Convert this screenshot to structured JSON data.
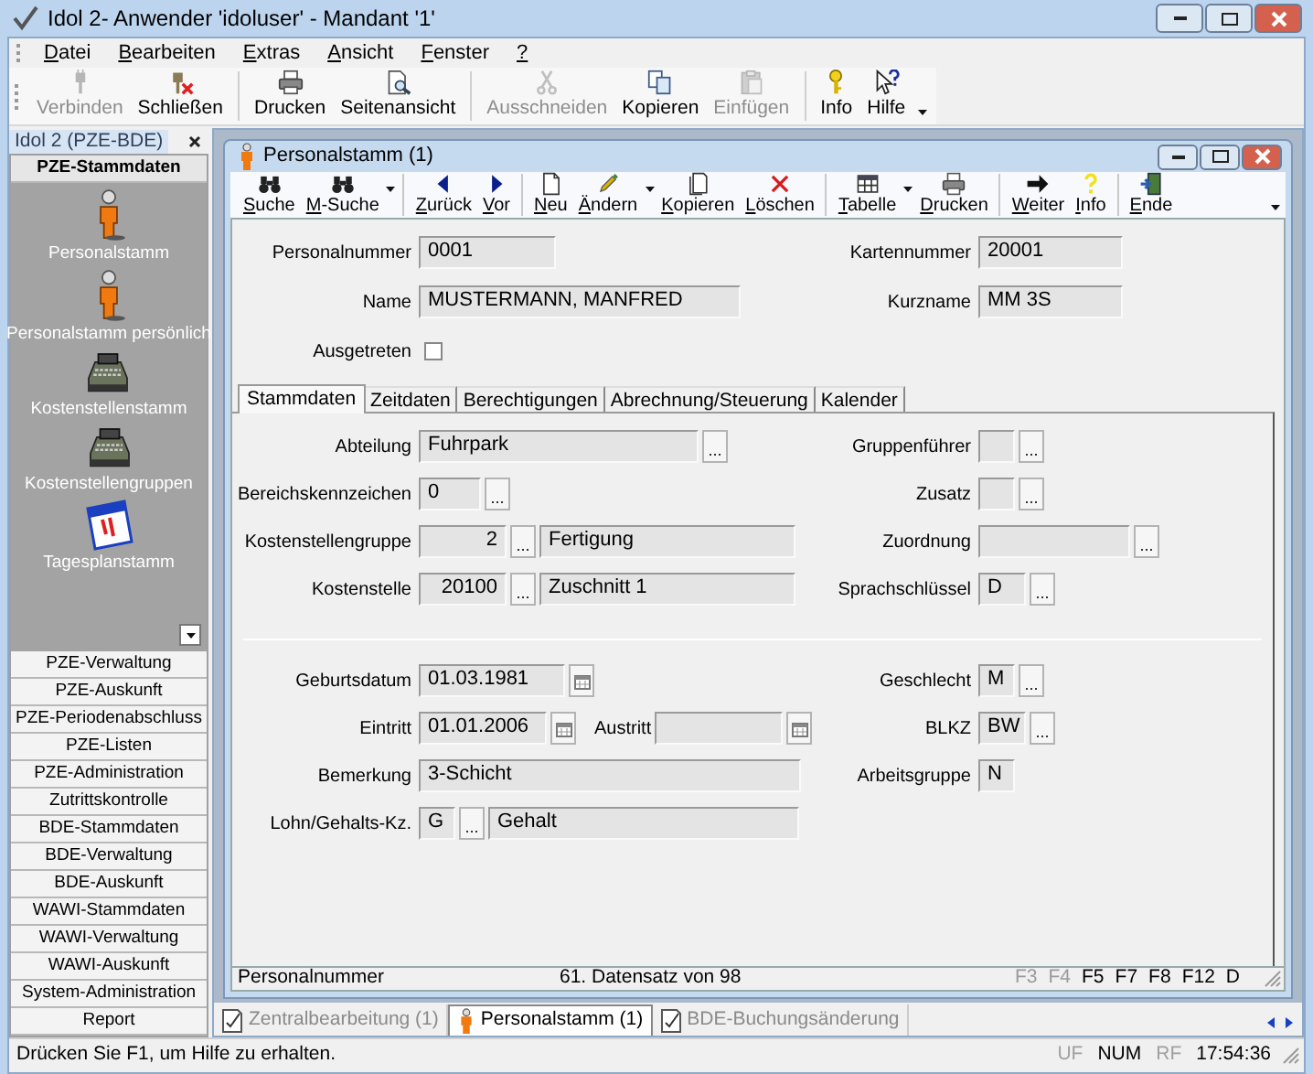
{
  "window": {
    "title": "Idol 2- Anwender 'idoluser' - Mandant '1'"
  },
  "menu": [
    "Datei",
    "Bearbeiten",
    "Extras",
    "Ansicht",
    "Fenster",
    "?"
  ],
  "toolbar": [
    [
      {
        "label": "Verbinden",
        "disabled": true
      },
      {
        "label": "Schließen",
        "disabled": false
      }
    ],
    [
      {
        "label": "Drucken",
        "disabled": false
      },
      {
        "label": "Seitenansicht",
        "disabled": false
      }
    ],
    [
      {
        "label": "Ausschneiden",
        "disabled": true
      },
      {
        "label": "Kopieren",
        "disabled": false
      },
      {
        "label": "Einfügen",
        "disabled": true
      }
    ],
    [
      {
        "label": "Info",
        "disabled": false
      },
      {
        "label": "Hilfe",
        "disabled": false
      }
    ]
  ],
  "sidebar": {
    "title": "Idol 2 (PZE-BDE)",
    "groups": [
      {
        "label": "PZE-Stammdaten",
        "expanded": true,
        "items": [
          {
            "label": "Personalstamm",
            "kind": "person"
          },
          {
            "label": "Personalstamm persönlich",
            "kind": "person"
          },
          {
            "label": "Kostenstellenstamm",
            "kind": "register"
          },
          {
            "label": "Kostenstellengruppen",
            "kind": "register"
          },
          {
            "label": "Tagesplanstamm",
            "kind": "calendar"
          }
        ]
      },
      {
        "label": "PZE-Verwaltung",
        "expanded": false
      },
      {
        "label": "PZE-Auskunft",
        "expanded": false
      },
      {
        "label": "PZE-Periodenabschluss",
        "expanded": false
      },
      {
        "label": "PZE-Listen",
        "expanded": false
      },
      {
        "label": "PZE-Administration",
        "expanded": false
      },
      {
        "label": "Zutrittskontrolle",
        "expanded": false
      },
      {
        "label": "BDE-Stammdaten",
        "expanded": false
      },
      {
        "label": "BDE-Verwaltung",
        "expanded": false
      },
      {
        "label": "BDE-Auskunft",
        "expanded": false
      },
      {
        "label": "WAWI-Stammdaten",
        "expanded": false
      },
      {
        "label": "WAWI-Verwaltung",
        "expanded": false
      },
      {
        "label": "WAWI-Auskunft",
        "expanded": false
      },
      {
        "label": "System-Administration",
        "expanded": false
      },
      {
        "label": "Report",
        "expanded": false
      }
    ]
  },
  "child": {
    "title": "Personalstamm (1)",
    "toolbar": [
      [
        {
          "label": "Suche",
          "dropdown": false
        },
        {
          "label": "M-Suche",
          "dropdown": true
        }
      ],
      [
        {
          "label": "Zurück",
          "dropdown": false
        },
        {
          "label": "Vor",
          "dropdown": false
        }
      ],
      [
        {
          "label": "Neu",
          "dropdown": false
        },
        {
          "label": "Ändern",
          "dropdown": true
        },
        {
          "label": "Kopieren",
          "dropdown": false
        },
        {
          "label": "Löschen",
          "dropdown": false
        }
      ],
      [
        {
          "label": "Tabelle",
          "dropdown": true
        },
        {
          "label": "Drucken",
          "dropdown": false
        }
      ],
      [
        {
          "label": "Weiter",
          "dropdown": false
        },
        {
          "label": "Info",
          "dropdown": false
        }
      ],
      [
        {
          "label": "Ende",
          "dropdown": false
        }
      ]
    ],
    "header": [
      {
        "left": [
          {
            "label": "Personalnummer",
            "parts": [
              {
                "kind": "field",
                "value": "0001"
              }
            ]
          }
        ],
        "right": {
          "label": "Kartennummer",
          "parts": [
            {
              "kind": "field",
              "value": "20001"
            }
          ]
        }
      },
      {
        "left": [
          {
            "label": "Name",
            "parts": [
              {
                "kind": "field",
                "value": "MUSTERMANN, MANFRED"
              }
            ]
          }
        ],
        "right": {
          "label": "Kurzname",
          "parts": [
            {
              "kind": "field",
              "value": "MM 3S"
            }
          ]
        }
      },
      {
        "left": [
          {
            "label": "Ausgetreten",
            "parts": [
              {
                "kind": "checkbox",
                "checked": false
              }
            ]
          }
        ]
      }
    ],
    "tabs": [
      {
        "label": "Stammdaten",
        "selected": true
      },
      {
        "label": "Zeitdaten",
        "selected": false
      },
      {
        "label": "Berechtigungen",
        "selected": false
      },
      {
        "label": "Abrechnung/Steuerung",
        "selected": false
      },
      {
        "label": "Kalender",
        "selected": false
      }
    ],
    "sections": [
      [
        {
          "left": [
            {
              "label": "Abteilung",
              "parts": [
                {
                  "kind": "field",
                  "value": "Fuhrpark"
                },
                {
                  "kind": "lookup"
                }
              ]
            }
          ],
          "right": {
            "label": "Gruppenführer",
            "parts": [
              {
                "kind": "field"
              },
              {
                "kind": "lookup"
              }
            ]
          }
        },
        {
          "left": [
            {
              "label": "Bereichskennzeichen",
              "parts": [
                {
                  "kind": "field",
                  "value": "0"
                },
                {
                  "kind": "lookup"
                }
              ]
            }
          ],
          "right": {
            "label": "Zusatz",
            "parts": [
              {
                "kind": "field"
              },
              {
                "kind": "lookup"
              }
            ]
          }
        },
        {
          "left": [
            {
              "label": "Kostenstellengruppe",
              "parts": [
                {
                  "kind": "field",
                  "value": "2"
                },
                {
                  "kind": "lookup"
                },
                {
                  "kind": "field",
                  "value": "Fertigung"
                }
              ]
            }
          ],
          "right": {
            "label": "Zuordnung",
            "parts": [
              {
                "kind": "field"
              },
              {
                "kind": "lookup"
              }
            ]
          }
        },
        {
          "left": [
            {
              "label": "Kostenstelle",
              "parts": [
                {
                  "kind": "field",
                  "value": "20100"
                },
                {
                  "kind": "lookup"
                },
                {
                  "kind": "field",
                  "value": "Zuschnitt 1"
                }
              ]
            }
          ],
          "right": {
            "label": "Sprachschlüssel",
            "parts": [
              {
                "kind": "field",
                "value": "D"
              },
              {
                "kind": "lookup"
              }
            ]
          }
        }
      ],
      [
        {
          "left": [
            {
              "label": "Geburtsdatum",
              "parts": [
                {
                  "kind": "field",
                  "value": "01.03.1981"
                },
                {
                  "kind": "calendar"
                }
              ]
            }
          ],
          "right": {
            "label": "Geschlecht",
            "parts": [
              {
                "kind": "field",
                "value": "M"
              },
              {
                "kind": "lookup"
              }
            ]
          }
        },
        {
          "left": [
            {
              "label": "Eintritt",
              "parts": [
                {
                  "kind": "field",
                  "value": "01.01.2006"
                },
                {
                  "kind": "calendar"
                }
              ]
            },
            {
              "label": "Austritt",
              "parts": [
                {
                  "kind": "field"
                },
                {
                  "kind": "calendar"
                }
              ]
            }
          ],
          "right": {
            "label": "BLKZ",
            "parts": [
              {
                "kind": "field",
                "value": "BW"
              },
              {
                "kind": "lookup"
              }
            ]
          }
        },
        {
          "left": [
            {
              "label": "Bemerkung",
              "parts": [
                {
                  "kind": "field",
                  "value": "3-Schicht"
                }
              ]
            }
          ],
          "right": {
            "label": "Arbeitsgruppe",
            "parts": [
              {
                "kind": "field",
                "value": "N"
              }
            ]
          }
        },
        {
          "left": [
            {
              "label": "Lohn/Gehalts-Kz.",
              "parts": [
                {
                  "kind": "field",
                  "value": "G"
                },
                {
                  "kind": "lookup"
                },
                {
                  "kind": "field",
                  "value": "Gehalt"
                }
              ]
            }
          ]
        }
      ]
    ],
    "status": {
      "field": "Personalnummer",
      "record": "61. Datensatz von 98",
      "keys": [
        {
          "label": "F3",
          "disabled": true
        },
        {
          "label": "F4",
          "disabled": true
        },
        {
          "label": "F5",
          "disabled": false
        },
        {
          "label": "F7",
          "disabled": false
        },
        {
          "label": "F8",
          "disabled": false
        },
        {
          "label": "F12",
          "disabled": false
        },
        {
          "label": "D",
          "disabled": false
        }
      ]
    }
  },
  "document_tabs": [
    {
      "label": "Zentralbearbeitung (1)",
      "selected": false
    },
    {
      "label": "Personalstamm (1)",
      "selected": true
    },
    {
      "label": "BDE-Buchungsänderung",
      "selected": false
    }
  ],
  "status_bar": {
    "message": "Drücken Sie F1, um Hilfe zu erhalten.",
    "indicators": [
      {
        "label": "UF",
        "disabled": true
      },
      {
        "label": "NUM",
        "disabled": false
      },
      {
        "label": "RF",
        "disabled": true
      },
      {
        "label": "17:54:36",
        "disabled": false
      }
    ]
  }
}
